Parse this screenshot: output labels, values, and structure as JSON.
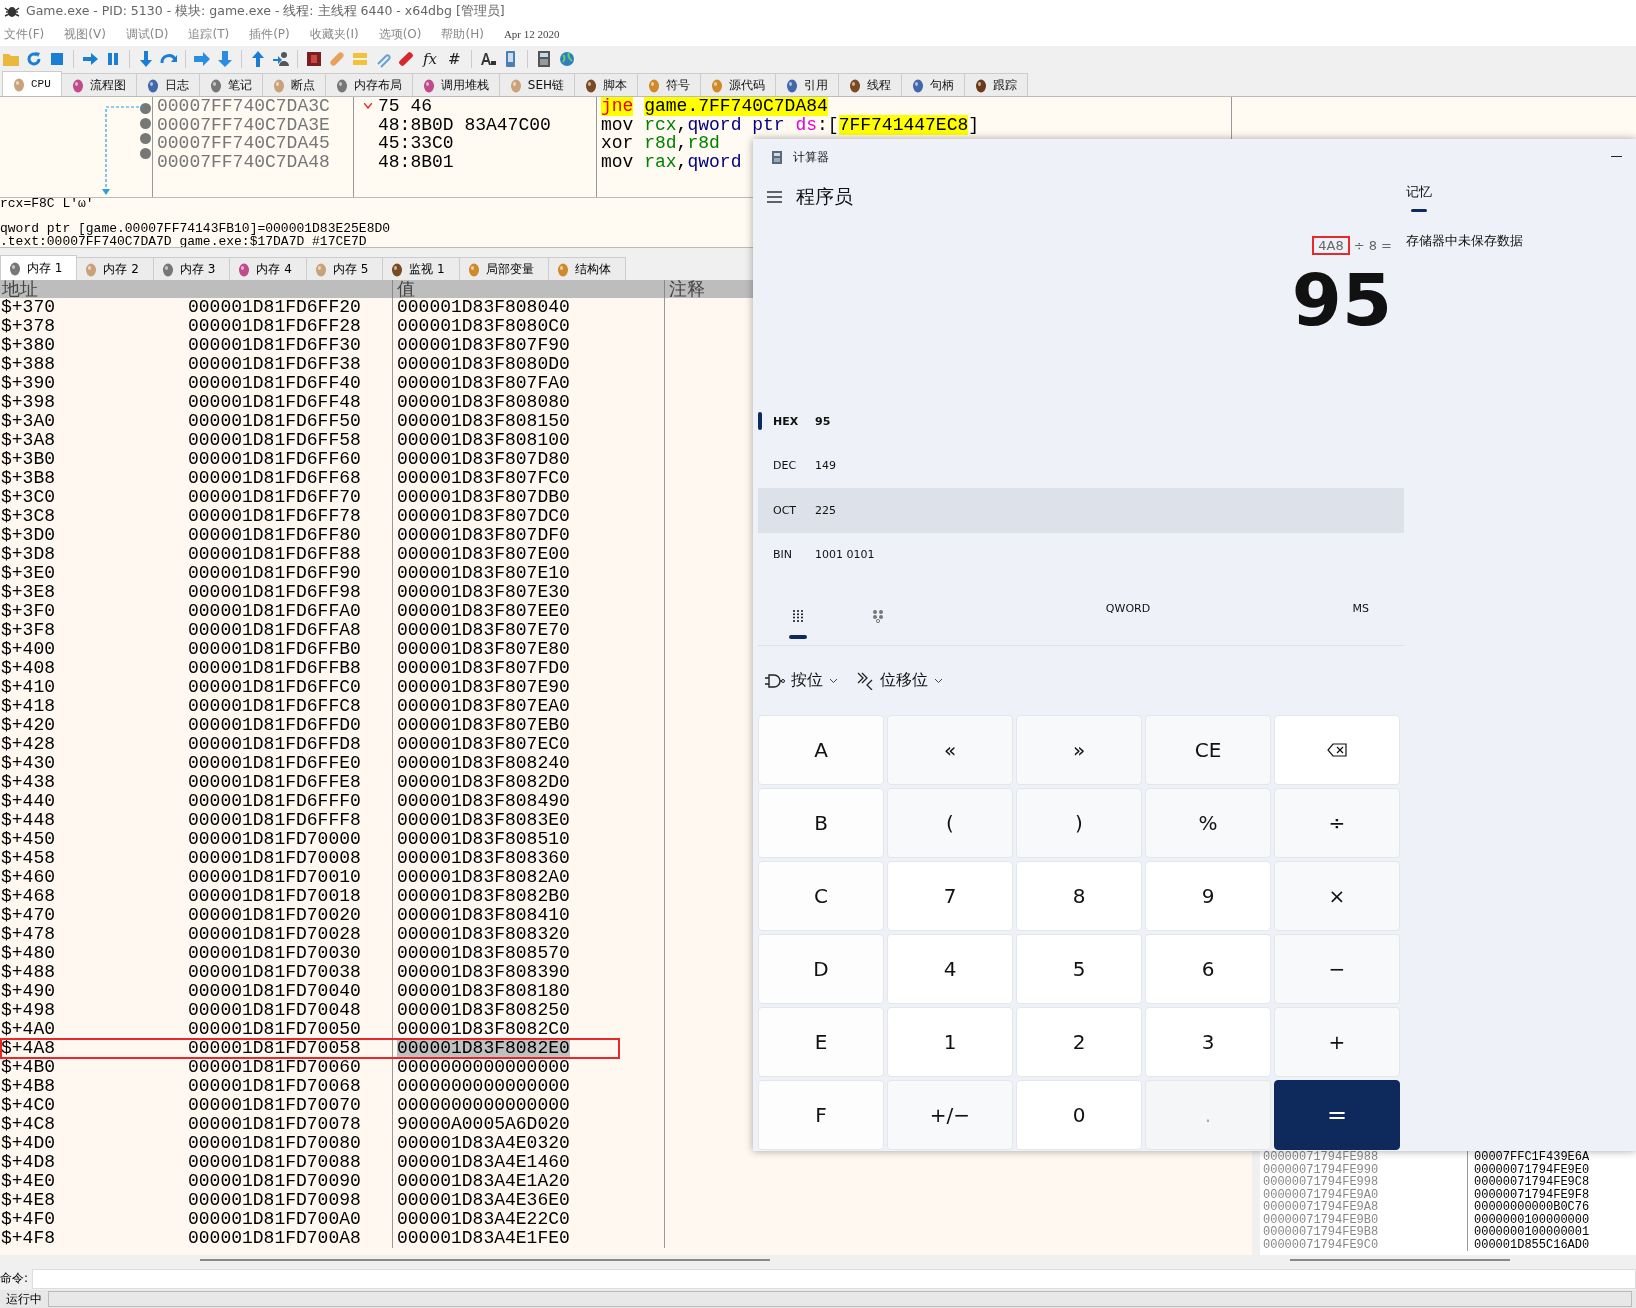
{
  "window": {
    "title": "Game.exe - PID: 5130 - 模块: game.exe - 线程: 主线程 6440 - x64dbg [管理员]"
  },
  "menu": [
    "文件(F)",
    "视图(V)",
    "调试(D)",
    "追踪(T)",
    "插件(P)",
    "收藏夹(I)",
    "选项(O)",
    "帮助(H)"
  ],
  "build_date": "Apr 12 2020",
  "toolbar": [
    {
      "kind": "folder"
    },
    {
      "kind": "restart"
    },
    {
      "kind": "stop"
    },
    {
      "kind": "sep"
    },
    {
      "kind": "run"
    },
    {
      "kind": "pause"
    },
    {
      "kind": "sep"
    },
    {
      "kind": "step_into"
    },
    {
      "kind": "step_over"
    },
    {
      "kind": "sep"
    },
    {
      "kind": "trace_into"
    },
    {
      "kind": "trace_over"
    },
    {
      "kind": "sep"
    },
    {
      "kind": "run_return"
    },
    {
      "kind": "run_user"
    },
    {
      "kind": "sep"
    },
    {
      "kind": "module"
    },
    {
      "kind": "patch"
    },
    {
      "kind": "note"
    },
    {
      "kind": "clip"
    },
    {
      "kind": "bookmark"
    },
    {
      "kind": "text",
      "label": "fx"
    },
    {
      "kind": "text",
      "label": "#"
    },
    {
      "kind": "sep"
    },
    {
      "kind": "font"
    },
    {
      "kind": "device"
    },
    {
      "kind": "sep"
    },
    {
      "kind": "calculator"
    },
    {
      "kind": "globe"
    }
  ],
  "tabs": [
    {
      "label": "CPU",
      "selected": true
    },
    {
      "label": "流程图",
      "selected": false
    },
    {
      "label": "日志",
      "selected": false
    },
    {
      "label": "笔记",
      "selected": false
    },
    {
      "label": "断点",
      "selected": false
    },
    {
      "label": "内存布局",
      "selected": false
    },
    {
      "label": "调用堆栈",
      "selected": false
    },
    {
      "label": "SEH链",
      "selected": false
    },
    {
      "label": "脚本",
      "selected": false
    },
    {
      "label": "符号",
      "selected": false
    },
    {
      "label": "源代码",
      "selected": false
    },
    {
      "label": "引用",
      "selected": false
    },
    {
      "label": "线程",
      "selected": false
    },
    {
      "label": "句柄",
      "selected": false
    },
    {
      "label": "跟踪",
      "selected": false
    }
  ],
  "disassembly": [
    {
      "address": "00007FF740C7DA3C",
      "bytes": "75 46",
      "branch_mark": true,
      "tokens": [
        {
          "text": "jne",
          "kind": "jump"
        },
        {
          "text": "game.7FF740C7DA84",
          "kind": "target"
        }
      ]
    },
    {
      "address": "00007FF740C7DA3E",
      "bytes": "48:8B0D 83A47C00",
      "branch_mark": false,
      "tokens": [
        {
          "text": "mov",
          "kind": "mnemonic"
        },
        {
          "text": "rcx",
          "kind": "register"
        },
        {
          "text": ",",
          "kind": "plain"
        },
        {
          "text": "qword ptr",
          "kind": "size"
        },
        {
          "text": "ds",
          "kind": "segment"
        },
        {
          "text": ":[",
          "kind": "plain"
        },
        {
          "text": "7FF741447EC8",
          "kind": "target"
        },
        {
          "text": "]",
          "kind": "plain"
        }
      ]
    },
    {
      "address": "00007FF740C7DA45",
      "bytes": "45:33C0",
      "branch_mark": false,
      "tokens": [
        {
          "text": "xor",
          "kind": "mnemonic"
        },
        {
          "text": "r8d",
          "kind": "register"
        },
        {
          "text": ",",
          "kind": "plain"
        },
        {
          "text": "r8d",
          "kind": "register"
        }
      ]
    },
    {
      "address": "00007FF740C7DA48",
      "bytes": "48:8B01",
      "branch_mark": false,
      "tokens": [
        {
          "text": "mov",
          "kind": "mnemonic"
        },
        {
          "text": "rax",
          "kind": "register"
        },
        {
          "text": ",",
          "kind": "plain"
        },
        {
          "text": "qword",
          "kind": "size"
        }
      ]
    }
  ],
  "info_lines": [
    "rcx=F8C L'ω'",
    "qword ptr [game.00007FF74143FB10]=000001D83E25E8D0",
    ".text:00007FF740C7DA7D game.exe:$17DA7D #17CE7D"
  ],
  "memory_tabs": [
    {
      "label": "内存 1",
      "selected": true
    },
    {
      "label": "内存 2",
      "selected": false
    },
    {
      "label": "内存 3",
      "selected": false
    },
    {
      "label": "内存 4",
      "selected": false
    },
    {
      "label": "内存 5",
      "selected": false
    },
    {
      "label": "监视 1",
      "selected": false
    },
    {
      "label": "局部变量",
      "selected": false
    },
    {
      "label": "结构体",
      "selected": false
    }
  ],
  "dump": {
    "columns": [
      "地址",
      "值",
      "注释"
    ],
    "rows": [
      {
        "offset": "$+370",
        "address": "000001D81FD6FF20",
        "value": "000001D83F808040",
        "selected": false,
        "marked": false
      },
      {
        "offset": "$+378",
        "address": "000001D81FD6FF28",
        "value": "000001D83F8080C0",
        "selected": false,
        "marked": false
      },
      {
        "offset": "$+380",
        "address": "000001D81FD6FF30",
        "value": "000001D83F807F90",
        "selected": false,
        "marked": false
      },
      {
        "offset": "$+388",
        "address": "000001D81FD6FF38",
        "value": "000001D83F8080D0",
        "selected": false,
        "marked": false
      },
      {
        "offset": "$+390",
        "address": "000001D81FD6FF40",
        "value": "000001D83F807FA0",
        "selected": false,
        "marked": false
      },
      {
        "offset": "$+398",
        "address": "000001D81FD6FF48",
        "value": "000001D83F808080",
        "selected": false,
        "marked": false
      },
      {
        "offset": "$+3A0",
        "address": "000001D81FD6FF50",
        "value": "000001D83F808150",
        "selected": false,
        "marked": false
      },
      {
        "offset": "$+3A8",
        "address": "000001D81FD6FF58",
        "value": "000001D83F808100",
        "selected": false,
        "marked": false
      },
      {
        "offset": "$+3B0",
        "address": "000001D81FD6FF60",
        "value": "000001D83F807D80",
        "selected": false,
        "marked": false
      },
      {
        "offset": "$+3B8",
        "address": "000001D81FD6FF68",
        "value": "000001D83F807FC0",
        "selected": false,
        "marked": false
      },
      {
        "offset": "$+3C0",
        "address": "000001D81FD6FF70",
        "value": "000001D83F807DB0",
        "selected": false,
        "marked": false
      },
      {
        "offset": "$+3C8",
        "address": "000001D81FD6FF78",
        "value": "000001D83F807DC0",
        "selected": false,
        "marked": false
      },
      {
        "offset": "$+3D0",
        "address": "000001D81FD6FF80",
        "value": "000001D83F807DF0",
        "selected": false,
        "marked": false
      },
      {
        "offset": "$+3D8",
        "address": "000001D81FD6FF88",
        "value": "000001D83F807E00",
        "selected": false,
        "marked": false
      },
      {
        "offset": "$+3E0",
        "address": "000001D81FD6FF90",
        "value": "000001D83F807E10",
        "selected": false,
        "marked": false
      },
      {
        "offset": "$+3E8",
        "address": "000001D81FD6FF98",
        "value": "000001D83F807E30",
        "selected": false,
        "marked": false
      },
      {
        "offset": "$+3F0",
        "address": "000001D81FD6FFA0",
        "value": "000001D83F807EE0",
        "selected": false,
        "marked": false
      },
      {
        "offset": "$+3F8",
        "address": "000001D81FD6FFA8",
        "value": "000001D83F807E70",
        "selected": false,
        "marked": false
      },
      {
        "offset": "$+400",
        "address": "000001D81FD6FFB0",
        "value": "000001D83F807E80",
        "selected": false,
        "marked": false
      },
      {
        "offset": "$+408",
        "address": "000001D81FD6FFB8",
        "value": "000001D83F807FD0",
        "selected": false,
        "marked": false
      },
      {
        "offset": "$+410",
        "address": "000001D81FD6FFC0",
        "value": "000001D83F807E90",
        "selected": false,
        "marked": false
      },
      {
        "offset": "$+418",
        "address": "000001D81FD6FFC8",
        "value": "000001D83F807EA0",
        "selected": false,
        "marked": false
      },
      {
        "offset": "$+420",
        "address": "000001D81FD6FFD0",
        "value": "000001D83F807EB0",
        "selected": false,
        "marked": false
      },
      {
        "offset": "$+428",
        "address": "000001D81FD6FFD8",
        "value": "000001D83F807EC0",
        "selected": false,
        "marked": false
      },
      {
        "offset": "$+430",
        "address": "000001D81FD6FFE0",
        "value": "000001D83F808240",
        "selected": false,
        "marked": false
      },
      {
        "offset": "$+438",
        "address": "000001D81FD6FFE8",
        "value": "000001D83F8082D0",
        "selected": false,
        "marked": false
      },
      {
        "offset": "$+440",
        "address": "000001D81FD6FFF0",
        "value": "000001D83F808490",
        "selected": false,
        "marked": false
      },
      {
        "offset": "$+448",
        "address": "000001D81FD6FFF8",
        "value": "000001D83F8083E0",
        "selected": false,
        "marked": false
      },
      {
        "offset": "$+450",
        "address": "000001D81FD70000",
        "value": "000001D83F808510",
        "selected": false,
        "marked": false
      },
      {
        "offset": "$+458",
        "address": "000001D81FD70008",
        "value": "000001D83F808360",
        "selected": false,
        "marked": false
      },
      {
        "offset": "$+460",
        "address": "000001D81FD70010",
        "value": "000001D83F8082A0",
        "selected": false,
        "marked": false
      },
      {
        "offset": "$+468",
        "address": "000001D81FD70018",
        "value": "000001D83F8082B0",
        "selected": false,
        "marked": false
      },
      {
        "offset": "$+470",
        "address": "000001D81FD70020",
        "value": "000001D83F808410",
        "selected": false,
        "marked": false
      },
      {
        "offset": "$+478",
        "address": "000001D81FD70028",
        "value": "000001D83F808320",
        "selected": false,
        "marked": false
      },
      {
        "offset": "$+480",
        "address": "000001D81FD70030",
        "value": "000001D83F808570",
        "selected": false,
        "marked": false
      },
      {
        "offset": "$+488",
        "address": "000001D81FD70038",
        "value": "000001D83F808390",
        "selected": false,
        "marked": false
      },
      {
        "offset": "$+490",
        "address": "000001D81FD70040",
        "value": "000001D83F808180",
        "selected": false,
        "marked": false
      },
      {
        "offset": "$+498",
        "address": "000001D81FD70048",
        "value": "000001D83F808250",
        "selected": false,
        "marked": false
      },
      {
        "offset": "$+4A0",
        "address": "000001D81FD70050",
        "value": "000001D83F8082C0",
        "selected": false,
        "marked": false
      },
      {
        "offset": "$+4A8",
        "address": "000001D81FD70058",
        "value": "000001D83F8082E0",
        "selected": true,
        "marked": true
      },
      {
        "offset": "$+4B0",
        "address": "000001D81FD70060",
        "value": "0000000000000000",
        "selected": false,
        "marked": false
      },
      {
        "offset": "$+4B8",
        "address": "000001D81FD70068",
        "value": "0000000000000000",
        "selected": false,
        "marked": false
      },
      {
        "offset": "$+4C0",
        "address": "000001D81FD70070",
        "value": "0000000000000000",
        "selected": false,
        "marked": false
      },
      {
        "offset": "$+4C8",
        "address": "000001D81FD70078",
        "value": "90000A0005A6D020",
        "selected": false,
        "marked": false
      },
      {
        "offset": "$+4D0",
        "address": "000001D81FD70080",
        "value": "000001D83A4E0320",
        "selected": false,
        "marked": false
      },
      {
        "offset": "$+4D8",
        "address": "000001D81FD70088",
        "value": "000001D83A4E1460",
        "selected": false,
        "marked": false
      },
      {
        "offset": "$+4E0",
        "address": "000001D81FD70090",
        "value": "000001D83A4E1A20",
        "selected": false,
        "marked": false
      },
      {
        "offset": "$+4E8",
        "address": "000001D81FD70098",
        "value": "000001D83A4E36E0",
        "selected": false,
        "marked": false
      },
      {
        "offset": "$+4F0",
        "address": "000001D81FD700A0",
        "value": "000001D83A4E22C0",
        "selected": false,
        "marked": false
      },
      {
        "offset": "$+4F8",
        "address": "000001D81FD700A8",
        "value": "000001D83A4E1FE0",
        "selected": false,
        "marked": false
      }
    ]
  },
  "stack": [
    {
      "address": "00000071794FE988",
      "value": "00007FFC1F439E6A"
    },
    {
      "address": "00000071794FE990",
      "value": "00000071794FE9E0"
    },
    {
      "address": "00000071794FE998",
      "value": "00000071794FE9C8"
    },
    {
      "address": "00000071794FE9A0",
      "value": "00000071794FE9F8"
    },
    {
      "address": "00000071794FE9A8",
      "value": "00000000000B0C76"
    },
    {
      "address": "00000071794FE9B0",
      "value": "0000000100000000"
    },
    {
      "address": "00000071794FE9B8",
      "value": "0000000100000001"
    },
    {
      "address": "00000071794FE9C0",
      "value": "000001D855C16AD0"
    }
  ],
  "command": {
    "label": "命令:"
  },
  "status": {
    "state": "运行中"
  },
  "calculator": {
    "title": "计算器",
    "mode": "程序员",
    "expression": [
      {
        "text": "4A8",
        "marked": true
      },
      {
        "text": "÷ 8 =",
        "marked": false
      }
    ],
    "result": "95",
    "radix": [
      {
        "label": "HEX",
        "value": "95",
        "selected": true,
        "hovered": false
      },
      {
        "label": "DEC",
        "value": "149",
        "selected": false,
        "hovered": false
      },
      {
        "label": "OCT",
        "value": "225",
        "selected": false,
        "hovered": true
      },
      {
        "label": "BIN",
        "value": "1001 0101",
        "selected": false,
        "hovered": false
      }
    ],
    "views": [
      {
        "kind": "keypad",
        "selected": true
      },
      {
        "kind": "bits",
        "selected": false
      }
    ],
    "word_size": "QWORD",
    "memory_store": "MS",
    "dropdowns": [
      {
        "label": "按位",
        "kind": "bitwise"
      },
      {
        "label": "位移位",
        "kind": "shift"
      }
    ],
    "keys": [
      {
        "label": "A",
        "kind": "letter",
        "disabled": false
      },
      {
        "label": "«",
        "kind": "op",
        "disabled": false
      },
      {
        "label": "»",
        "kind": "op",
        "disabled": false
      },
      {
        "label": "CE",
        "kind": "op",
        "disabled": false
      },
      {
        "kind": "backspace",
        "disabled": false
      },
      {
        "label": "B",
        "kind": "letter",
        "disabled": false
      },
      {
        "label": "(",
        "kind": "op",
        "disabled": false
      },
      {
        "label": ")",
        "kind": "op",
        "disabled": false
      },
      {
        "label": "%",
        "kind": "op",
        "disabled": false
      },
      {
        "label": "÷",
        "kind": "op",
        "disabled": false
      },
      {
        "label": "C",
        "kind": "letter",
        "disabled": false
      },
      {
        "label": "7",
        "kind": "digit",
        "disabled": false
      },
      {
        "label": "8",
        "kind": "digit",
        "disabled": false
      },
      {
        "label": "9",
        "kind": "digit",
        "disabled": false
      },
      {
        "label": "×",
        "kind": "op",
        "disabled": false
      },
      {
        "label": "D",
        "kind": "letter",
        "disabled": false
      },
      {
        "label": "4",
        "kind": "digit",
        "disabled": false
      },
      {
        "label": "5",
        "kind": "digit",
        "disabled": false
      },
      {
        "label": "6",
        "kind": "digit",
        "disabled": false
      },
      {
        "label": "−",
        "kind": "op",
        "disabled": false
      },
      {
        "label": "E",
        "kind": "letter",
        "disabled": false
      },
      {
        "label": "1",
        "kind": "digit",
        "disabled": false
      },
      {
        "label": "2",
        "kind": "digit",
        "disabled": false
      },
      {
        "label": "3",
        "kind": "digit",
        "disabled": false
      },
      {
        "label": "+",
        "kind": "op",
        "disabled": false
      },
      {
        "label": "F",
        "kind": "letter",
        "disabled": false
      },
      {
        "label": "+/−",
        "kind": "op",
        "disabled": false
      },
      {
        "label": "0",
        "kind": "digit",
        "disabled": false
      },
      {
        "label": ".",
        "kind": "digit",
        "disabled": true
      },
      {
        "label": "=",
        "kind": "equals",
        "disabled": false
      }
    ],
    "memory": {
      "heading": "记忆",
      "empty_text": "存储器中未保存数据"
    }
  }
}
